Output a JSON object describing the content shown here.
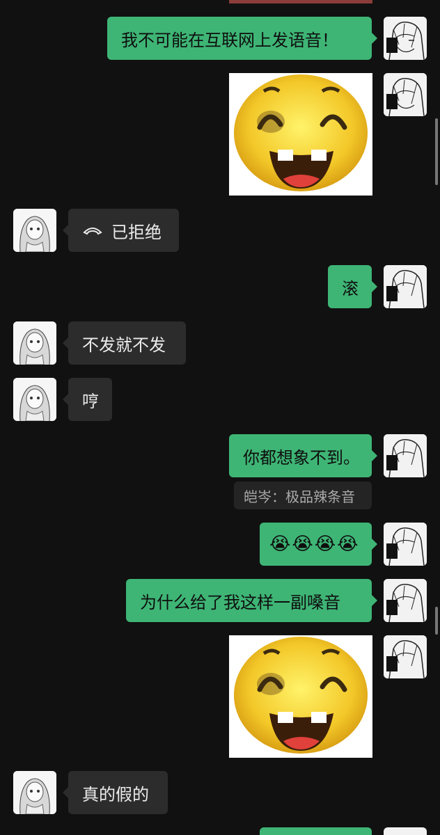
{
  "messages": {
    "m1": "我不可能在互联网上发语音！",
    "m3": "已拒绝",
    "m4": "滚",
    "m5": "不发就不发",
    "m6": "哼",
    "m7": "你都想象不到。",
    "m7_quote": "皑岑：极品辣条音",
    "m8_emojis": [
      "😭",
      "😭",
      "😭",
      "😭"
    ],
    "m9": "为什么给了我这样一副嗓音",
    "m11": "真的假的"
  },
  "icons": {
    "avatar_self": "manga-portrait-avatar",
    "avatar_other": "anime-girl-avatar",
    "sticker": "laughing-yellow-face-sticker",
    "call": "hangup-phone-icon"
  },
  "colors": {
    "background": "#111111",
    "outgoing_bubble": "#3eb575",
    "incoming_bubble": "#2c2c2c"
  }
}
